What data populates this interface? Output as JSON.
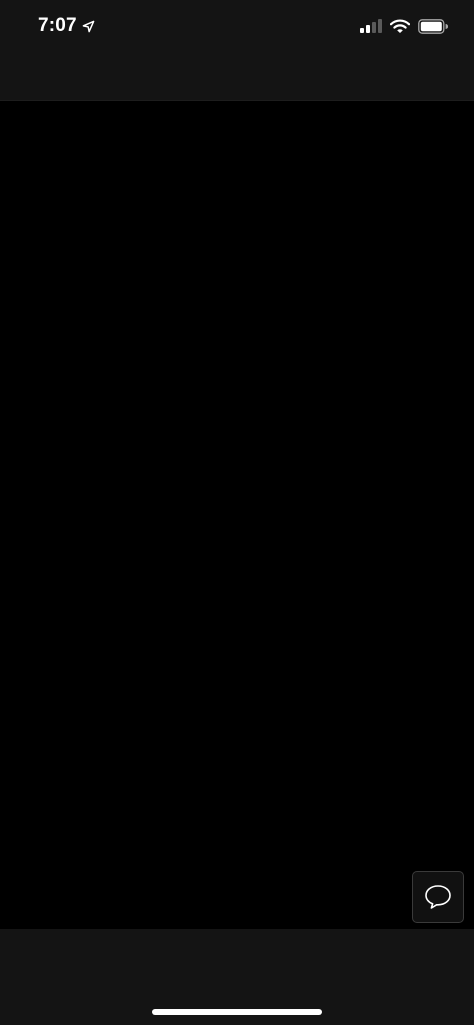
{
  "status_bar": {
    "time": "7:07",
    "location_icon": "location-arrow-icon",
    "signal_icon": "cellular-signal-icon",
    "wifi_icon": "wifi-icon",
    "battery_icon": "battery-icon"
  },
  "chat": {
    "icon": "speech-bubble-icon"
  },
  "colors": {
    "background": "#000000",
    "bars": "#141414",
    "chat_border": "#3a3a3a",
    "foreground": "#ffffff",
    "signal_dim": "#5a5a5a"
  }
}
